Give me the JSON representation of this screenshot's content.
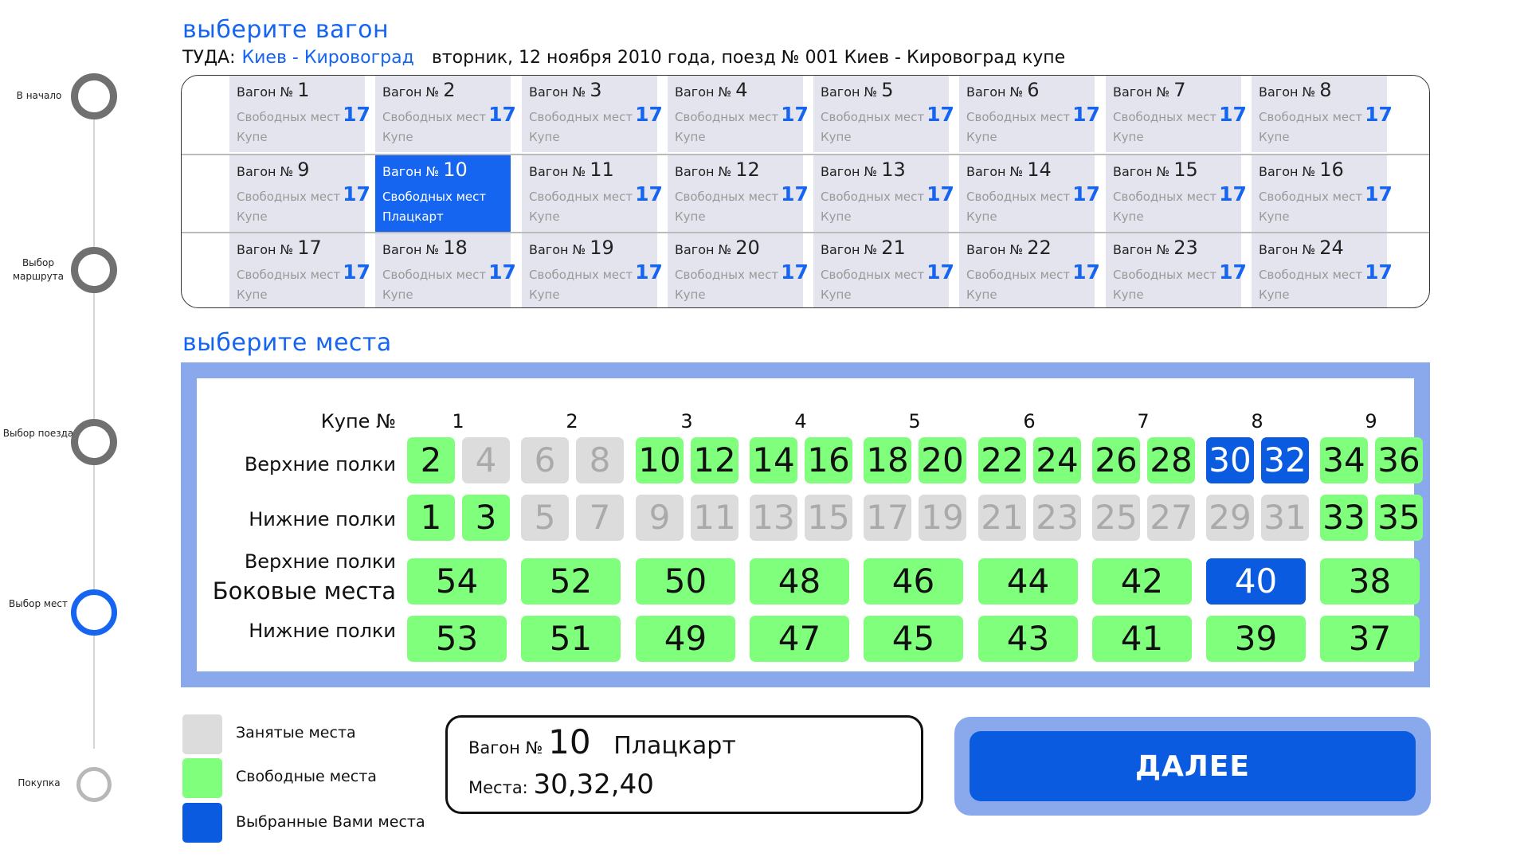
{
  "stepper": [
    {
      "label": "В начало"
    },
    {
      "label": "Выбор маршрута"
    },
    {
      "label": "Выбор поезда"
    },
    {
      "label": "Выбор мест"
    },
    {
      "label": "Покупка"
    }
  ],
  "headings": {
    "choose_wagon": "выберите вагон",
    "choose_seats": "выберите места"
  },
  "route": {
    "direction": "ТУДА:",
    "cities": "Киев - Кировоград",
    "info": "вторник, 12 ноября 2010 года, поезд № 001 Киев - Кировоград купе"
  },
  "wagon_labels": {
    "prefix": "Вагон №",
    "free": "Свободных мест"
  },
  "wagons": [
    {
      "number": "1",
      "free": "17",
      "type": "Купе"
    },
    {
      "number": "2",
      "free": "17",
      "type": "Купе"
    },
    {
      "number": "3",
      "free": "17",
      "type": "Купе"
    },
    {
      "number": "4",
      "free": "17",
      "type": "Купе"
    },
    {
      "number": "5",
      "free": "17",
      "type": "Купе"
    },
    {
      "number": "6",
      "free": "17",
      "type": "Купе"
    },
    {
      "number": "7",
      "free": "17",
      "type": "Купе"
    },
    {
      "number": "8",
      "free": "17",
      "type": "Купе"
    },
    {
      "number": "9",
      "free": "17",
      "type": "Купе"
    },
    {
      "number": "10",
      "free": "",
      "type": "Плацкарт",
      "selected": true
    },
    {
      "number": "11",
      "free": "17",
      "type": "Купе"
    },
    {
      "number": "12",
      "free": "17",
      "type": "Купе"
    },
    {
      "number": "13",
      "free": "17",
      "type": "Купе"
    },
    {
      "number": "14",
      "free": "17",
      "type": "Купе"
    },
    {
      "number": "15",
      "free": "17",
      "type": "Купе"
    },
    {
      "number": "16",
      "free": "17",
      "type": "Купе"
    },
    {
      "number": "17",
      "free": "17",
      "type": "Купе"
    },
    {
      "number": "18",
      "free": "17",
      "type": "Купе"
    },
    {
      "number": "19",
      "free": "17",
      "type": "Купе"
    },
    {
      "number": "20",
      "free": "17",
      "type": "Купе"
    },
    {
      "number": "21",
      "free": "17",
      "type": "Купе"
    },
    {
      "number": "22",
      "free": "17",
      "type": "Купе"
    },
    {
      "number": "23",
      "free": "17",
      "type": "Купе"
    },
    {
      "number": "24",
      "free": "17",
      "type": "Купе"
    }
  ],
  "seat_labels": {
    "kupe": "Купе №",
    "upper": "Верхние полки",
    "lower": "Нижние полки",
    "side": "Боковые места",
    "side_upper": "Верхние полки",
    "side_lower": "Нижние полки"
  },
  "compartments": [
    "1",
    "2",
    "3",
    "4",
    "5",
    "6",
    "7",
    "8",
    "9"
  ],
  "upper_seats": [
    {
      "n": "2",
      "s": "free"
    },
    {
      "n": "4",
      "s": "taken"
    },
    {
      "n": "6",
      "s": "taken"
    },
    {
      "n": "8",
      "s": "taken"
    },
    {
      "n": "10",
      "s": "free"
    },
    {
      "n": "12",
      "s": "free"
    },
    {
      "n": "14",
      "s": "free"
    },
    {
      "n": "16",
      "s": "free"
    },
    {
      "n": "18",
      "s": "free"
    },
    {
      "n": "20",
      "s": "free"
    },
    {
      "n": "22",
      "s": "free"
    },
    {
      "n": "24",
      "s": "free"
    },
    {
      "n": "26",
      "s": "free"
    },
    {
      "n": "28",
      "s": "free"
    },
    {
      "n": "30",
      "s": "chosen"
    },
    {
      "n": "32",
      "s": "chosen"
    },
    {
      "n": "34",
      "s": "free"
    },
    {
      "n": "36",
      "s": "free"
    }
  ],
  "lower_seats": [
    {
      "n": "1",
      "s": "free"
    },
    {
      "n": "3",
      "s": "free"
    },
    {
      "n": "5",
      "s": "taken"
    },
    {
      "n": "7",
      "s": "taken"
    },
    {
      "n": "9",
      "s": "taken"
    },
    {
      "n": "11",
      "s": "taken"
    },
    {
      "n": "13",
      "s": "taken"
    },
    {
      "n": "15",
      "s": "taken"
    },
    {
      "n": "17",
      "s": "taken"
    },
    {
      "n": "19",
      "s": "taken"
    },
    {
      "n": "21",
      "s": "taken"
    },
    {
      "n": "23",
      "s": "taken"
    },
    {
      "n": "25",
      "s": "taken"
    },
    {
      "n": "27",
      "s": "taken"
    },
    {
      "n": "29",
      "s": "taken"
    },
    {
      "n": "31",
      "s": "taken"
    },
    {
      "n": "33",
      "s": "free"
    },
    {
      "n": "35",
      "s": "free"
    }
  ],
  "side_upper_seats": [
    {
      "n": "54",
      "s": "free"
    },
    {
      "n": "52",
      "s": "free"
    },
    {
      "n": "50",
      "s": "free"
    },
    {
      "n": "48",
      "s": "free"
    },
    {
      "n": "46",
      "s": "free"
    },
    {
      "n": "44",
      "s": "free"
    },
    {
      "n": "42",
      "s": "free"
    },
    {
      "n": "40",
      "s": "chosen"
    },
    {
      "n": "38",
      "s": "free"
    }
  ],
  "side_lower_seats": [
    {
      "n": "53",
      "s": "free"
    },
    {
      "n": "51",
      "s": "free"
    },
    {
      "n": "49",
      "s": "free"
    },
    {
      "n": "47",
      "s": "free"
    },
    {
      "n": "45",
      "s": "free"
    },
    {
      "n": "43",
      "s": "free"
    },
    {
      "n": "41",
      "s": "free"
    },
    {
      "n": "39",
      "s": "free"
    },
    {
      "n": "37",
      "s": "free"
    }
  ],
  "legend": {
    "taken": "Занятые места",
    "free": "Свободные места",
    "chosen": "Выбранные Вами места"
  },
  "colors": {
    "taken": "#dcdcdc",
    "free": "#80ff7c",
    "chosen": "#0a5be0",
    "accent": "#1565f0",
    "frame": "#8aa9ec"
  },
  "summary": {
    "wagon_prefix": "Вагон №",
    "wagon_number": "10",
    "wagon_type": "Плацкарт",
    "seats_label": "Места:",
    "seats_value": "30,32,40"
  },
  "next_button": "ДАЛЕЕ"
}
